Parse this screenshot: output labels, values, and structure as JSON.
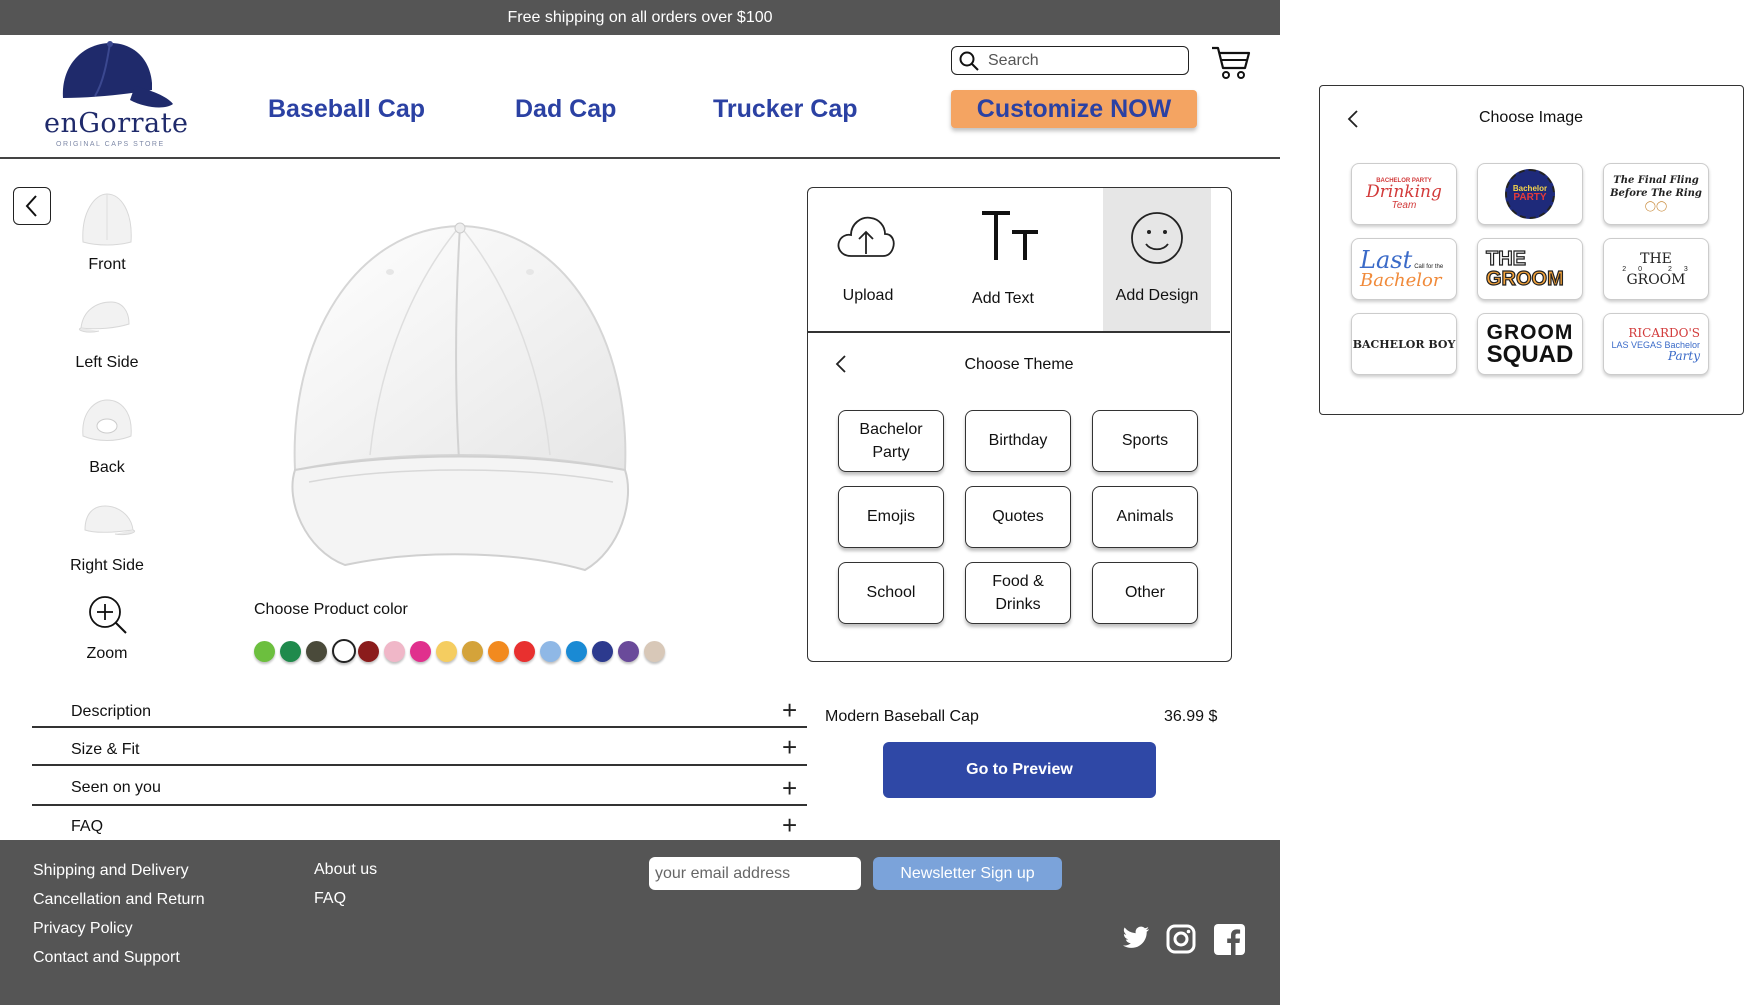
{
  "topbar": {
    "text": "Free shipping on all orders over $100"
  },
  "brand": {
    "name": "enGorrate",
    "tagline": "ORIGINAL CAPS STORE"
  },
  "nav": {
    "items": [
      "Baseball Cap",
      "Dad Cap",
      "Trucker Cap"
    ],
    "cta": "Customize NOW"
  },
  "search": {
    "placeholder": "Search"
  },
  "views": {
    "items": [
      "Front",
      "Left Side",
      "Back",
      "Right Side"
    ],
    "zoom": "Zoom"
  },
  "color": {
    "title": "Choose Product color",
    "swatches": [
      "#6cbf3e",
      "#1f8a4c",
      "#4a4a3a",
      "#ffffff",
      "#8b1c1c",
      "#f0b7c8",
      "#e0308d",
      "#f5cd60",
      "#d4a33a",
      "#f28a1f",
      "#e8302f",
      "#8fb8e6",
      "#1a8ad4",
      "#2c3a8e",
      "#6a4a9a",
      "#d8c8b8"
    ],
    "selected_index": 3
  },
  "accordion": [
    "Description",
    "Size & Fit",
    "Seen on you",
    "FAQ"
  ],
  "tools": {
    "upload": "Upload",
    "add_text": "Add Text",
    "add_design": "Add Design"
  },
  "theme": {
    "title": "Choose Theme",
    "items": [
      [
        "Bachelor",
        "Party"
      ],
      [
        "Birthday"
      ],
      [
        "Sports"
      ],
      [
        "Emojis"
      ],
      [
        "Quotes"
      ],
      [
        "Animals"
      ],
      [
        "School"
      ],
      [
        "Food &",
        "Drinks"
      ],
      [
        "Other"
      ]
    ]
  },
  "product": {
    "name": "Modern Baseball Cap",
    "price": "36.99 $",
    "preview_button": "Go to Preview"
  },
  "footer": {
    "col1": [
      "Shipping and Delivery",
      "Cancellation and Return",
      "Privacy Policy",
      "Contact and Support"
    ],
    "col2": [
      "About us",
      "FAQ"
    ],
    "email_placeholder": "your email address",
    "newsletter_button": "Newsletter Sign up"
  },
  "image_panel": {
    "title": "Choose Image",
    "designs": [
      {
        "line1": "BACHELOR PARTY",
        "line2": "Drinking",
        "line3": "Team"
      },
      {
        "line1": "Bachelor",
        "line2": "PARTY",
        "line3": ""
      },
      {
        "line1": "The Final Fling",
        "line2": "Before The Ring",
        "line3": ""
      },
      {
        "line1": "Last",
        "line2": "Call for the",
        "line3": "Bachelor"
      },
      {
        "line1": "THE",
        "line2": "GROOM",
        "line3": ""
      },
      {
        "line1": "THE",
        "line2": "20 23",
        "line3": "GROOM"
      },
      {
        "line1": "BACHELOR BOY",
        "line2": "",
        "line3": ""
      },
      {
        "line1": "GROOM",
        "line2": "SQUAD",
        "line3": ""
      },
      {
        "line1": "RICARDO'S",
        "line2": "LAS VEGAS Bachelor",
        "line3": "Party"
      }
    ]
  }
}
